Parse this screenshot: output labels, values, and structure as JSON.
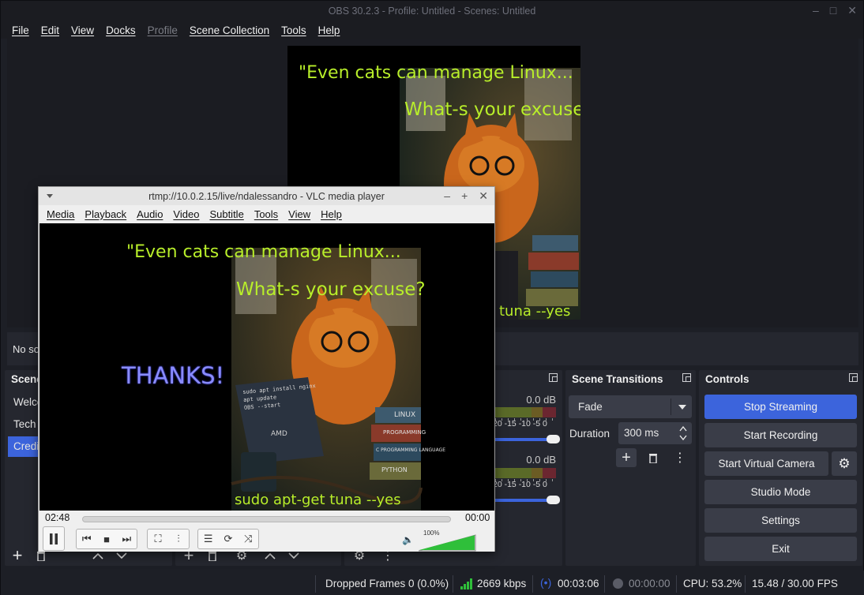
{
  "obs": {
    "title": "OBS 30.2.3 - Profile: Untitled - Scenes: Untitled",
    "window_controls": [
      "–",
      "□",
      "✕"
    ],
    "menu": [
      {
        "label": "File",
        "enabled": true
      },
      {
        "label": "Edit",
        "enabled": true
      },
      {
        "label": "View",
        "enabled": true
      },
      {
        "label": "Docks",
        "enabled": true
      },
      {
        "label": "Profile",
        "enabled": false
      },
      {
        "label": "Scene Collection",
        "enabled": true
      },
      {
        "label": "Tools",
        "enabled": true
      },
      {
        "label": "Help",
        "enabled": true
      }
    ],
    "preview": {
      "quote_line1": "\"Even cats can manage Linux...",
      "quote_line2": "What-s your excuse?",
      "bottom_caption": "tuna --yes"
    },
    "source_info_text": "No so",
    "scenes_dock": {
      "title": "Scene",
      "items": [
        {
          "label": "Welco",
          "selected": false
        },
        {
          "label": "Tech",
          "selected": false
        },
        {
          "label": "Credi",
          "selected": true
        }
      ]
    },
    "audio_mixer": {
      "channels": [
        {
          "db": "0.0 dB",
          "scale": "20 -15 -10 -5 0"
        },
        {
          "db": "0.0 dB",
          "scale": "20 -15 -10 -5 0"
        }
      ]
    },
    "scene_transitions": {
      "title": "Scene Transitions",
      "selected": "Fade",
      "duration_label": "Duration",
      "duration_value": "300 ms"
    },
    "controls": {
      "title": "Controls",
      "buttons": {
        "stop_streaming": "Stop Streaming",
        "start_recording": "Start Recording",
        "start_virtual_camera": "Start Virtual Camera",
        "studio_mode": "Studio Mode",
        "settings": "Settings",
        "exit": "Exit"
      }
    },
    "status_bar": {
      "dropped_frames": "Dropped Frames 0 (0.0%)",
      "bitrate": "2669 kbps",
      "stream_time": "00:03:06",
      "record_time": "00:00:00",
      "cpu": "CPU: 53.2%",
      "fps": "15.48 / 30.00 FPS",
      "colors": {
        "bitrate_icon": "#2fbf3a",
        "stream_icon": "#3c64dc"
      }
    }
  },
  "vlc": {
    "title": "rtmp://10.0.2.15/live/ndalessandro - VLC media player",
    "window_controls": [
      "–",
      "+",
      "✕"
    ],
    "menu": [
      "Media",
      "Playback",
      "Audio",
      "Video",
      "Subtitle",
      "Tools",
      "View",
      "Help"
    ],
    "video": {
      "quote_line1": "\"Even cats can manage Linux...",
      "quote_line2": "What-s your excuse?",
      "thanks": "THANKS!",
      "laptop_text": "sudo apt install nginx\napt update\nOBS --start",
      "book_labels": [
        "LINUX",
        "PROGRAMMING",
        "C PROGRAMMING LANGUAGE",
        "PYTHON"
      ],
      "laptop_brand": "AMD",
      "bottom_caption": "sudo apt-get tuna --yes"
    },
    "controls": {
      "elapsed": "02:48",
      "remaining": "00:00",
      "volume": "100%",
      "volume_level": 1.0
    }
  }
}
